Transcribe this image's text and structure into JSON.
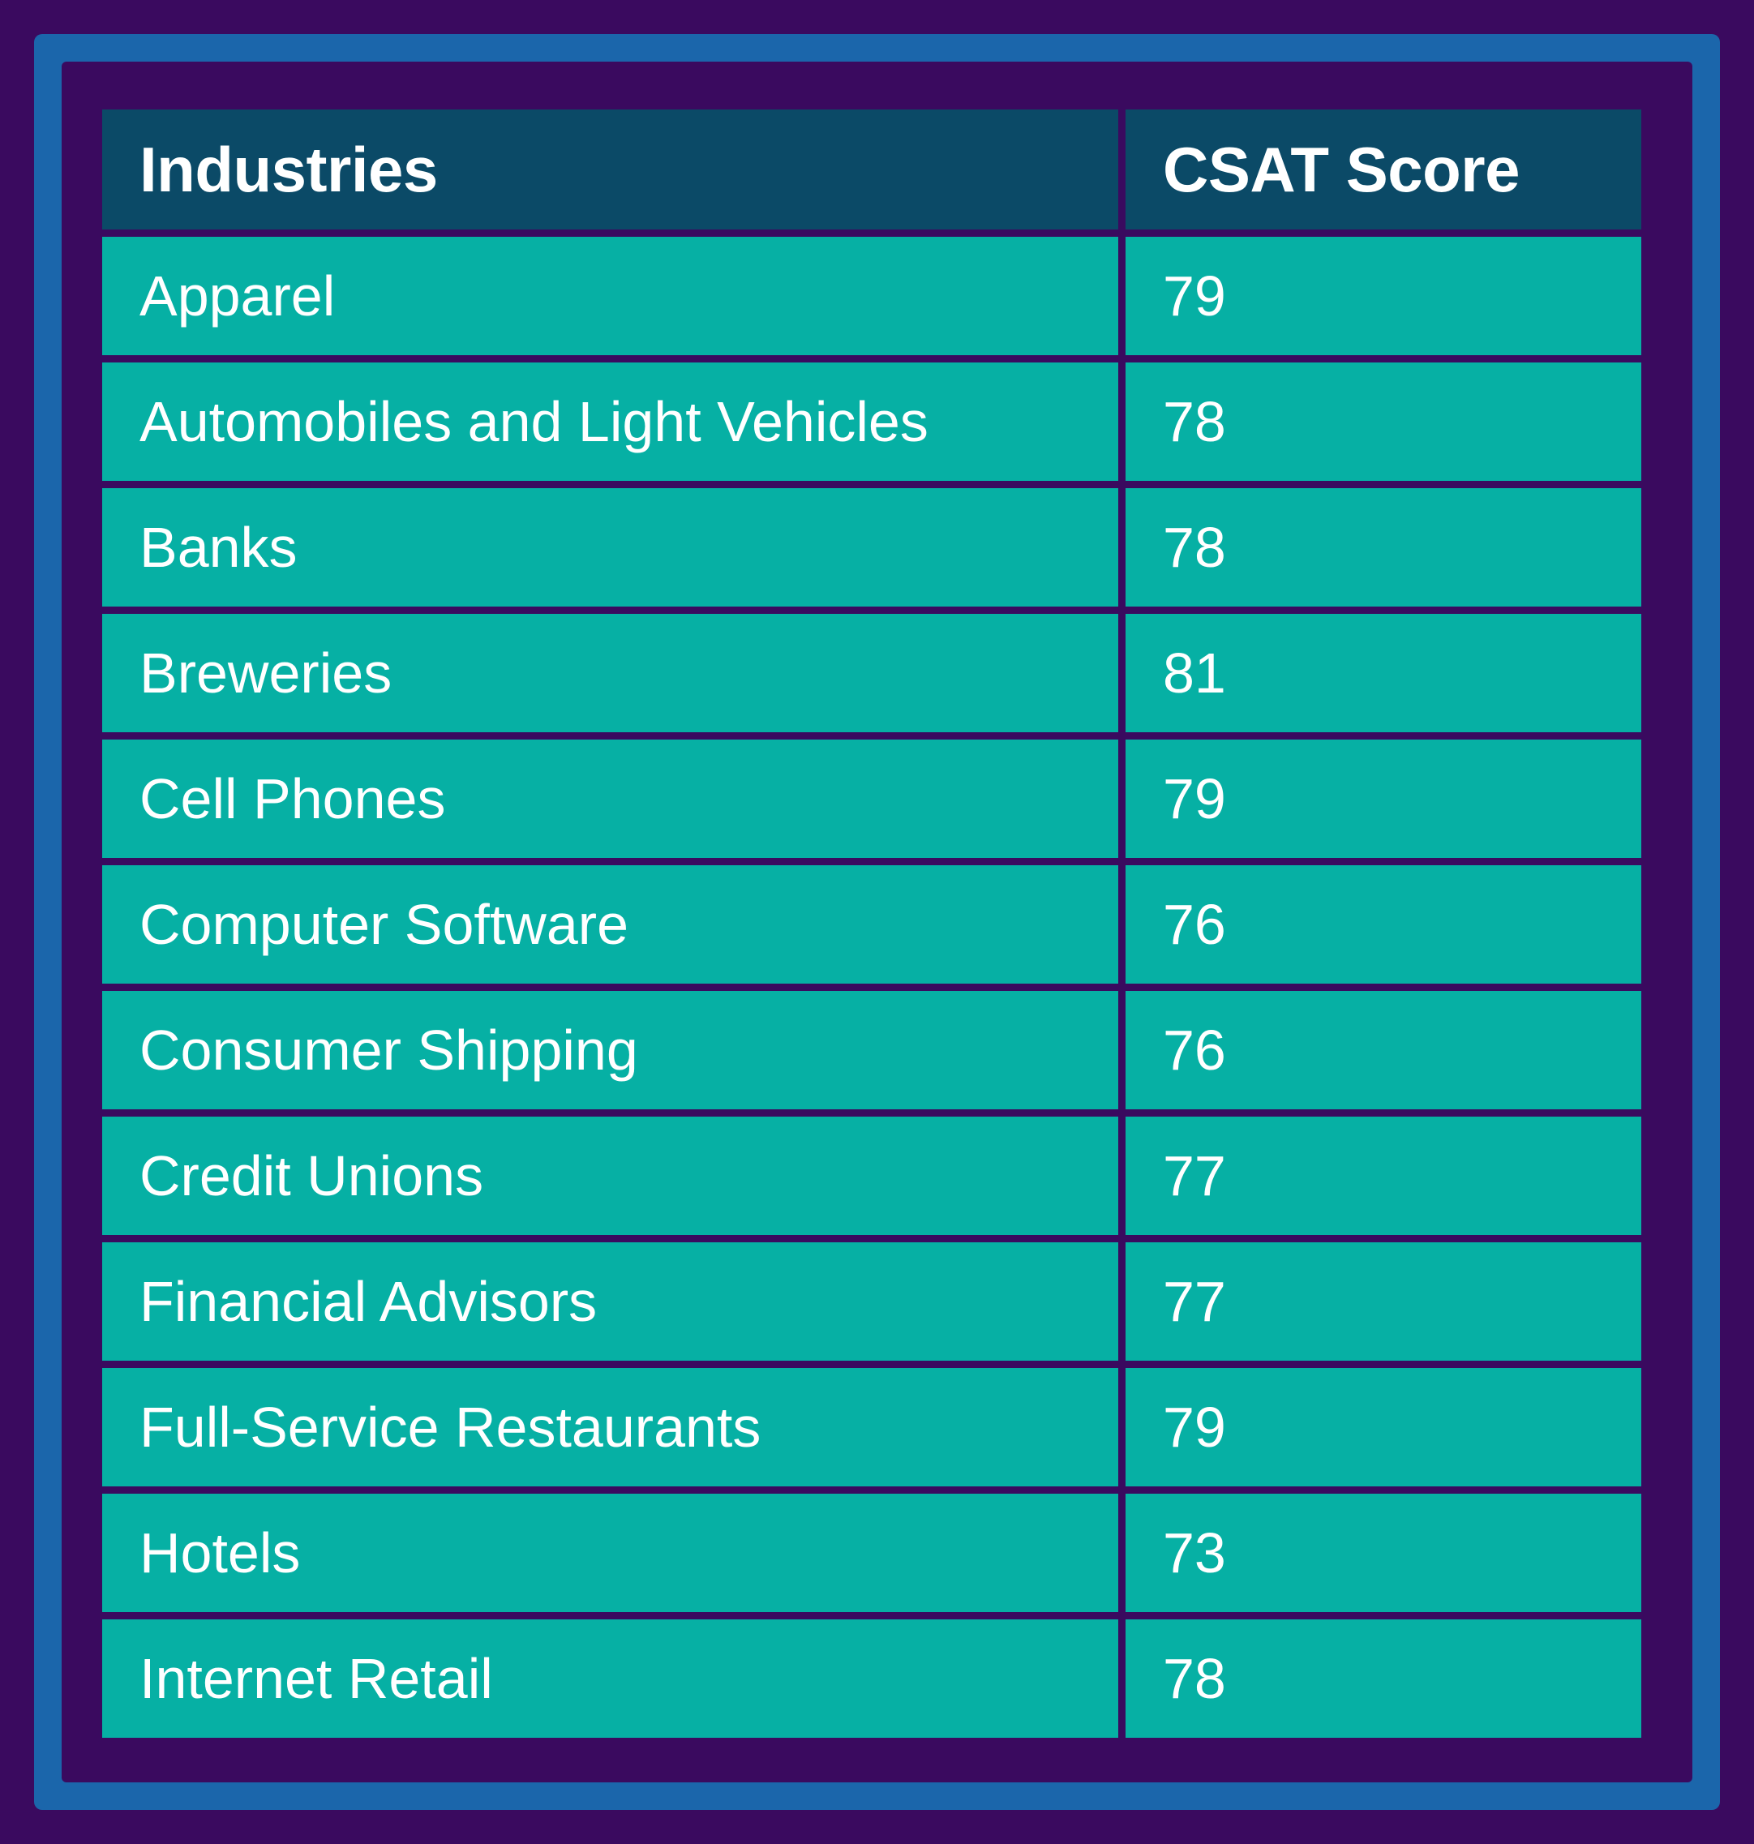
{
  "theme": {
    "outer_background": "#3a0a5f",
    "frame_accent": "#1b66ab",
    "header_background": "#0b4a67",
    "row_background": "#06b0a4",
    "text_color": "#ffffff"
  },
  "table": {
    "columns": [
      "Industries",
      "CSAT Score"
    ],
    "rows": [
      {
        "industry": "Apparel",
        "score": "79"
      },
      {
        "industry": "Automobiles and Light Vehicles",
        "score": "78"
      },
      {
        "industry": "Banks",
        "score": "78"
      },
      {
        "industry": "Breweries",
        "score": "81"
      },
      {
        "industry": "Cell Phones",
        "score": "79"
      },
      {
        "industry": "Computer Software",
        "score": "76"
      },
      {
        "industry": "Consumer Shipping",
        "score": "76"
      },
      {
        "industry": "Credit Unions",
        "score": "77"
      },
      {
        "industry": "Financial Advisors",
        "score": "77"
      },
      {
        "industry": "Full-Service Restaurants",
        "score": "79"
      },
      {
        "industry": "Hotels",
        "score": "73"
      },
      {
        "industry": "Internet Retail",
        "score": "78"
      }
    ]
  },
  "chart_data": {
    "type": "table",
    "title": "",
    "columns": [
      "Industries",
      "CSAT Score"
    ],
    "categories": [
      "Apparel",
      "Automobiles and Light Vehicles",
      "Banks",
      "Breweries",
      "Cell Phones",
      "Computer Software",
      "Consumer Shipping",
      "Credit Unions",
      "Financial Advisors",
      "Full-Service Restaurants",
      "Hotels",
      "Internet Retail"
    ],
    "values": [
      79,
      78,
      78,
      81,
      79,
      76,
      76,
      77,
      77,
      79,
      73,
      78
    ],
    "xlabel": "Industries",
    "ylabel": "CSAT Score",
    "ylim": [
      0,
      100
    ]
  }
}
